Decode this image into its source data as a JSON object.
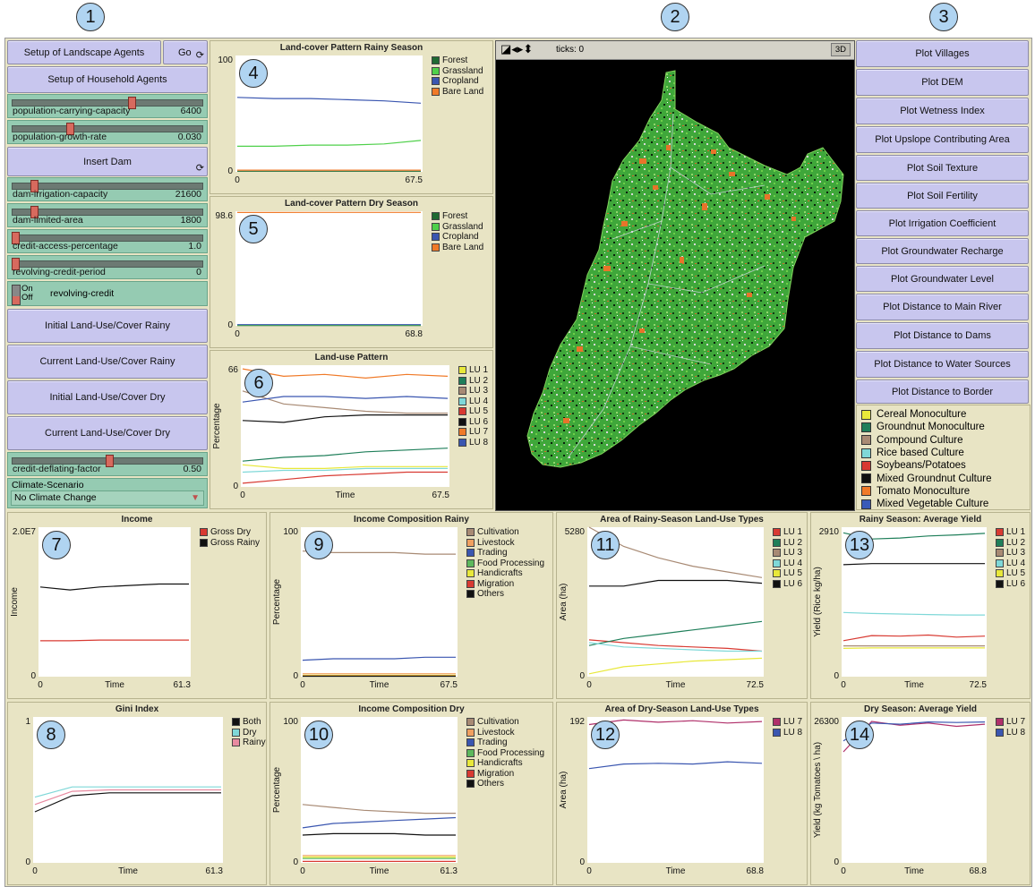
{
  "callouts": [
    "1",
    "2",
    "3",
    "4",
    "5",
    "6",
    "7",
    "8",
    "9",
    "10",
    "11",
    "12",
    "13",
    "14"
  ],
  "left_panel": {
    "setup_landscape": "Setup of Landscape Agents",
    "go": "Go",
    "setup_household": "Setup of Household Agents",
    "insert_dam": "Insert Dam",
    "switch_on": "On",
    "switch_off": "Off",
    "switch_label": "revolving-credit",
    "initial_rainy": "Initial Land-Use/Cover Rainy",
    "current_rainy": "Current Land-Use/Cover Rainy",
    "initial_dry": "Initial Land-Use/Cover Dry",
    "current_dry": "Current Land-Use/Cover Dry",
    "climate_label": "Climate-Scenario",
    "climate_value": "No Climate Change",
    "sliders": [
      {
        "label": "population-carrying-capacity",
        "value": "6400",
        "level": 0.62
      },
      {
        "label": "population-growth-rate",
        "value": "0.030",
        "level": 0.29
      },
      {
        "label": "dam-irrigation-capacity",
        "value": "21600",
        "level": 0.1
      },
      {
        "label": "dam-limited-area",
        "value": "1800",
        "level": 0.1
      },
      {
        "label": "credit-access-percentage",
        "value": "1.0",
        "level": 0.0
      },
      {
        "label": "revolving-credit-period",
        "value": "0",
        "level": 0.0
      },
      {
        "label": "credit-deflating-factor",
        "value": "0.50",
        "level": 0.5
      }
    ]
  },
  "view": {
    "ticks": "ticks: 0",
    "three_d": "3D"
  },
  "right_buttons": [
    "Plot Villages",
    "Plot DEM",
    "Plot Wetness Index",
    "Plot Upslope Contributing Area",
    "Plot Soil Texture",
    "Plot Soil Fertility",
    "Plot Irrigation Coefficient",
    "Plot Groundwater Recharge",
    "Plot Groundwater Level",
    "Plot Distance to Main River",
    "Plot Distance to Dams",
    "Plot Distance to Water Sources",
    "Plot Distance to Border"
  ],
  "map_legend": [
    {
      "label": "Cereal Monoculture",
      "color": "#e8e83a"
    },
    {
      "label": "Groundnut Monoculture",
      "color": "#1f7f5a"
    },
    {
      "label": "Compound Culture",
      "color": "#a88a74"
    },
    {
      "label": "Rice based Culture",
      "color": "#7fd8d8"
    },
    {
      "label": "Soybeans/Potatoes",
      "color": "#d83a32"
    },
    {
      "label": "Mixed Groundnut Culture",
      "color": "#111111"
    },
    {
      "label": "Tomato Monoculture",
      "color": "#f07a28"
    },
    {
      "label": "Mixed Vegetable Culture",
      "color": "#3a5ab8"
    }
  ],
  "chart_data": [
    {
      "id": "lc_rainy",
      "type": "line",
      "title": "Land-cover Pattern Rainy Season",
      "xlabel": "",
      "ylabel": "",
      "xlim": [
        0,
        67.5
      ],
      "ylim": [
        0,
        100
      ],
      "x_tick_labels": [
        "0",
        "67.5"
      ],
      "y_tick_labels": [
        "0",
        "100"
      ],
      "series": [
        {
          "name": "Forest",
          "color": "#1f6a32",
          "values": [
            0.5,
            0.5,
            0.5,
            0.5,
            0.5,
            0.5
          ]
        },
        {
          "name": "Grassland",
          "color": "#4fd04a",
          "values": [
            22,
            22,
            23,
            23,
            24,
            27
          ]
        },
        {
          "name": "Cropland",
          "color": "#3a56b0",
          "values": [
            64,
            63,
            63,
            62,
            61,
            59
          ]
        },
        {
          "name": "Bare Land",
          "color": "#f07a28",
          "values": [
            1.5,
            1.5,
            1.5,
            1.5,
            1.5,
            1.5
          ]
        }
      ]
    },
    {
      "id": "lc_dry",
      "type": "line",
      "title": "Land-cover Pattern Dry Season",
      "xlabel": "",
      "ylabel": "",
      "xlim": [
        0,
        68.8
      ],
      "ylim": [
        0,
        98.6
      ],
      "x_tick_labels": [
        "0",
        "68.8"
      ],
      "y_tick_labels": [
        "0",
        "98.6"
      ],
      "series": [
        {
          "name": "Forest",
          "color": "#1f6a32",
          "values": [
            0.3,
            0.3,
            0.3,
            0.3,
            0.3,
            0.3
          ]
        },
        {
          "name": "Grassland",
          "color": "#4fd04a",
          "values": [
            0.6,
            0.6,
            0.6,
            0.6,
            0.6,
            0.6
          ]
        },
        {
          "name": "Cropland",
          "color": "#3a56b0",
          "values": [
            1,
            1,
            1,
            1,
            1,
            1
          ]
        },
        {
          "name": "Bare Land",
          "color": "#f07a28",
          "values": [
            97.5,
            97.5,
            97.6,
            97.6,
            97.6,
            97.6
          ]
        }
      ]
    },
    {
      "id": "lu_pattern",
      "type": "line",
      "title": "Land-use Pattern",
      "xlabel": "Time",
      "ylabel": "Percentage",
      "xlim": [
        0,
        67.5
      ],
      "ylim": [
        0,
        66
      ],
      "x_tick_labels": [
        "0",
        "67.5"
      ],
      "y_tick_labels": [
        "0",
        "66"
      ],
      "series": [
        {
          "name": "LU 1",
          "color": "#e8e83a",
          "values": [
            12,
            10,
            10,
            11,
            11,
            11
          ]
        },
        {
          "name": "LU 2",
          "color": "#1f7f5a",
          "values": [
            14,
            16,
            17,
            19,
            20,
            21
          ]
        },
        {
          "name": "LU 3",
          "color": "#a88a74",
          "values": [
            52,
            45,
            43,
            41,
            40,
            40
          ]
        },
        {
          "name": "LU 4",
          "color": "#7fd8d8",
          "values": [
            8,
            9,
            9,
            10,
            10,
            10
          ]
        },
        {
          "name": "LU 5",
          "color": "#d83a32",
          "values": [
            2,
            4,
            6,
            7,
            8,
            8
          ]
        },
        {
          "name": "LU 6",
          "color": "#111111",
          "values": [
            36,
            35,
            38,
            39,
            39,
            39
          ]
        },
        {
          "name": "LU 7",
          "color": "#f07a28",
          "values": [
            64,
            60,
            61,
            59,
            61,
            60
          ]
        },
        {
          "name": "LU 8",
          "color": "#3a56b0",
          "values": [
            46,
            49,
            49,
            48,
            49,
            48
          ]
        }
      ]
    },
    {
      "id": "income",
      "type": "line",
      "title": "Income",
      "xlabel": "Time",
      "ylabel": "Income",
      "xlim": [
        0,
        61.3
      ],
      "ylim": [
        0,
        20000000.0
      ],
      "x_tick_labels": [
        "0",
        "61.3"
      ],
      "y_tick_labels": [
        "0",
        "2.0E7"
      ],
      "series": [
        {
          "name": "Gross Dry",
          "color": "#d83a32",
          "values": [
            4800000.0,
            4800000.0,
            4900000.0,
            4900000.0,
            4900000.0,
            4900000.0
          ]
        },
        {
          "name": "Gross Rainy",
          "color": "#111111",
          "values": [
            12000000.0,
            11600000.0,
            12000000.0,
            12200000.0,
            12400000.0,
            12400000.0
          ]
        }
      ]
    },
    {
      "id": "gini",
      "type": "line",
      "title": "Gini Index",
      "xlabel": "Time",
      "ylabel": "",
      "xlim": [
        0,
        61.3
      ],
      "ylim": [
        0,
        1
      ],
      "x_tick_labels": [
        "0",
        "61.3"
      ],
      "y_tick_labels": [
        "0",
        "1"
      ],
      "series": [
        {
          "name": "Both",
          "color": "#111111",
          "values": [
            0.35,
            0.46,
            0.48,
            0.48,
            0.48,
            0.48
          ]
        },
        {
          "name": "Dry",
          "color": "#7fd8d8",
          "values": [
            0.45,
            0.52,
            0.52,
            0.52,
            0.52,
            0.52
          ]
        },
        {
          "name": "Rainy",
          "color": "#e88aa0",
          "values": [
            0.4,
            0.49,
            0.5,
            0.5,
            0.5,
            0.5
          ]
        }
      ]
    },
    {
      "id": "inc_comp_rainy",
      "type": "line",
      "title": "Income Composition Rainy",
      "xlabel": "Time",
      "ylabel": "Percentage",
      "xlim": [
        0,
        67.5
      ],
      "ylim": [
        0,
        100
      ],
      "x_tick_labels": [
        "0",
        "67.5"
      ],
      "y_tick_labels": [
        "0",
        "100"
      ],
      "series": [
        {
          "name": "Cultivation",
          "color": "#a88a74",
          "values": [
            84,
            83,
            83,
            83,
            82,
            82
          ]
        },
        {
          "name": "Livestock",
          "color": "#f0a060",
          "values": [
            2,
            2,
            2,
            2,
            2,
            2
          ]
        },
        {
          "name": "Trading",
          "color": "#3a56b0",
          "values": [
            11,
            12,
            12,
            12,
            13,
            13
          ]
        },
        {
          "name": "Food Processing",
          "color": "#5cb85c",
          "values": [
            0.5,
            0.5,
            0.5,
            0.5,
            0.5,
            0.5
          ]
        },
        {
          "name": "Handicrafts",
          "color": "#e8e83a",
          "values": [
            1,
            1,
            1,
            1,
            1,
            1
          ]
        },
        {
          "name": "Migration",
          "color": "#d83a32",
          "values": [
            0.5,
            0.5,
            0.5,
            0.5,
            0.5,
            0.5
          ]
        },
        {
          "name": "Others",
          "color": "#111111",
          "values": [
            0.3,
            0.3,
            0.3,
            0.3,
            0.3,
            0.3
          ]
        }
      ]
    },
    {
      "id": "inc_comp_dry",
      "type": "line",
      "title": "Income Composition Dry",
      "xlabel": "Time",
      "ylabel": "Percentage",
      "xlim": [
        0,
        61.3
      ],
      "ylim": [
        0,
        100
      ],
      "x_tick_labels": [
        "0",
        "61.3"
      ],
      "y_tick_labels": [
        "0",
        "100"
      ],
      "series": [
        {
          "name": "Cultivation",
          "color": "#a88a74",
          "values": [
            40,
            38,
            36,
            35,
            34,
            34
          ]
        },
        {
          "name": "Livestock",
          "color": "#f0a060",
          "values": [
            5,
            5,
            5,
            5,
            5,
            5
          ]
        },
        {
          "name": "Trading",
          "color": "#3a56b0",
          "values": [
            24,
            27,
            28,
            29,
            30,
            31
          ]
        },
        {
          "name": "Food Processing",
          "color": "#5cb85c",
          "values": [
            3,
            3,
            3,
            3,
            3,
            3
          ]
        },
        {
          "name": "Handicrafts",
          "color": "#e8e83a",
          "values": [
            4,
            4,
            4,
            4,
            4,
            4
          ]
        },
        {
          "name": "Migration",
          "color": "#d83a32",
          "values": [
            1,
            1,
            1,
            1,
            1,
            1
          ]
        },
        {
          "name": "Others",
          "color": "#111111",
          "values": [
            19,
            20,
            20,
            20,
            19,
            19
          ]
        }
      ]
    },
    {
      "id": "area_rainy",
      "type": "line",
      "title": "Area of Rainy-Season Land-Use Types",
      "xlabel": "Time",
      "ylabel": "Area (ha)",
      "xlim": [
        0,
        72.5
      ],
      "ylim": [
        0,
        5280
      ],
      "x_tick_labels": [
        "0",
        "72.5"
      ],
      "y_tick_labels": [
        "0",
        "5280"
      ],
      "series": [
        {
          "name": "LU 1",
          "color": "#d83a32",
          "values": [
            1300,
            1200,
            1100,
            1050,
            1000,
            900
          ]
        },
        {
          "name": "LU 2",
          "color": "#1f7f5a",
          "values": [
            1100,
            1350,
            1500,
            1650,
            1800,
            1950
          ]
        },
        {
          "name": "LU 3",
          "color": "#a88a74",
          "values": [
            5280,
            4600,
            4200,
            3900,
            3700,
            3500
          ]
        },
        {
          "name": "LU 4",
          "color": "#7fd8d8",
          "values": [
            1200,
            1050,
            1000,
            950,
            900,
            900
          ]
        },
        {
          "name": "LU 5",
          "color": "#e8e83a",
          "values": [
            100,
            350,
            450,
            550,
            600,
            650
          ]
        },
        {
          "name": "LU 6",
          "color": "#111111",
          "values": [
            3200,
            3200,
            3400,
            3400,
            3400,
            3300
          ]
        }
      ]
    },
    {
      "id": "area_dry",
      "type": "line",
      "title": "Area of Dry-Season Land-Use Types",
      "xlabel": "Time",
      "ylabel": "Area (ha)",
      "xlim": [
        0,
        68.8
      ],
      "ylim": [
        0,
        192
      ],
      "x_tick_labels": [
        "0",
        "68.8"
      ],
      "y_tick_labels": [
        "0",
        "192"
      ],
      "series": [
        {
          "name": "LU 7",
          "color": "#b0306a",
          "values": [
            182,
            188,
            185,
            187,
            184,
            186
          ]
        },
        {
          "name": "LU 8",
          "color": "#3a56b0",
          "values": [
            124,
            130,
            131,
            130,
            133,
            131
          ]
        }
      ]
    },
    {
      "id": "yield_rainy",
      "type": "line",
      "title": "Rainy Season: Average Yield",
      "xlabel": "Time",
      "ylabel": "Yield (Rice kg/ha)",
      "xlim": [
        0,
        72.5
      ],
      "ylim": [
        0,
        2910
      ],
      "x_tick_labels": [
        "0",
        "72.5"
      ],
      "y_tick_labels": [
        "0",
        "2910"
      ],
      "series": [
        {
          "name": "LU 1",
          "color": "#d83a32",
          "values": [
            700,
            800,
            790,
            810,
            770,
            790
          ]
        },
        {
          "name": "LU 2",
          "color": "#1f7f5a",
          "values": [
            2800,
            2680,
            2700,
            2740,
            2760,
            2790
          ]
        },
        {
          "name": "LU 3",
          "color": "#a88a74",
          "values": [
            600,
            600,
            600,
            600,
            600,
            600
          ]
        },
        {
          "name": "LU 4",
          "color": "#7fd8d8",
          "values": [
            1250,
            1230,
            1220,
            1210,
            1200,
            1200
          ]
        },
        {
          "name": "LU 5",
          "color": "#e8e83a",
          "values": [
            550,
            560,
            560,
            560,
            560,
            560
          ]
        },
        {
          "name": "LU 6",
          "color": "#111111",
          "values": [
            2180,
            2200,
            2200,
            2200,
            2200,
            2200
          ]
        }
      ]
    },
    {
      "id": "yield_dry",
      "type": "line",
      "title": "Dry Season: Average Yield",
      "xlabel": "Time",
      "ylabel": "Yield (kg Tomatoes \\ ha)",
      "xlim": [
        0,
        68.8
      ],
      "ylim": [
        0,
        26300
      ],
      "x_tick_labels": [
        "0",
        "68.8"
      ],
      "y_tick_labels": [
        "0",
        "26300"
      ],
      "series": [
        {
          "name": "LU 7",
          "color": "#b0306a",
          "values": [
            20000,
            25500,
            24800,
            25200,
            24600,
            25000
          ]
        },
        {
          "name": "LU 8",
          "color": "#3a56b0",
          "values": [
            22000,
            25200,
            25000,
            25400,
            25300,
            25400
          ]
        }
      ]
    }
  ]
}
